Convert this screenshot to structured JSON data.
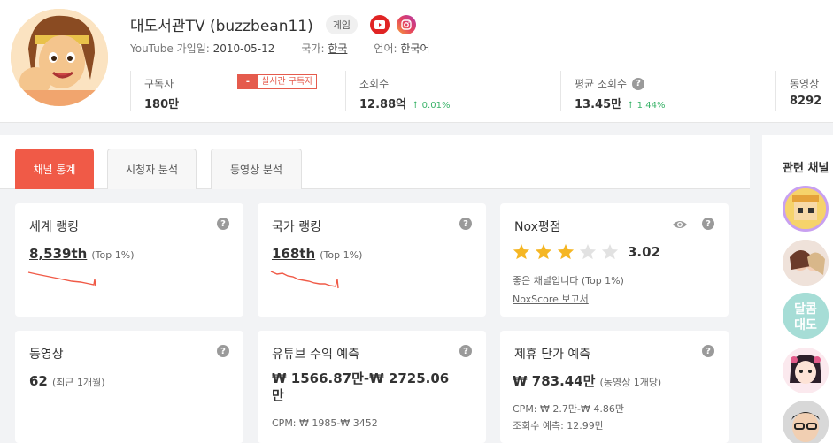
{
  "channel": {
    "name": "대도서관TV (buzzbean11)",
    "category": "게임",
    "joined_label": "YouTube 가입일:",
    "joined_value": "2010-05-12",
    "country_label": "국가:",
    "country_value": "한국",
    "language_label": "언어:",
    "language_value": "한국어"
  },
  "stats": {
    "subscribers_label": "구독자",
    "subscribers_value": "180만",
    "realtime_dash": "-",
    "realtime_label": "실시간 구독자",
    "views_label": "조회수",
    "views_value": "12.88억",
    "views_change": "0.01%",
    "avg_views_label": "평균 조회수",
    "avg_views_value": "13.45만",
    "avg_views_change": "1.44%",
    "videos_label": "동영상",
    "videos_value": "8292"
  },
  "tabs": [
    {
      "label": "채널 통계",
      "active": true
    },
    {
      "label": "시청자 분석",
      "active": false
    },
    {
      "label": "동영상 분석",
      "active": false
    }
  ],
  "cards": {
    "world_rank": {
      "title": "세계 랭킹",
      "value": "8,539th",
      "sub": "(Top 1%)"
    },
    "country_rank": {
      "title": "국가 랭킹",
      "value": "168th",
      "sub": "(Top 1%)"
    },
    "nox": {
      "title": "Nox평점",
      "score": "3.02",
      "stars": 3,
      "desc": "좋은 채널입니다 (Top 1%)",
      "report": "NoxScore 보고서"
    },
    "videos": {
      "title": "동영상",
      "value": "62",
      "sub": "(최근 1개월)"
    },
    "revenue": {
      "title": "유튜브 수익 예측",
      "value_line1": "₩ 1566.87만-₩ 2725.06",
      "value_line2": "만",
      "cpm": "CPM: ₩ 1985-₩ 3452"
    },
    "affiliate": {
      "title": "제휴 단가 예측",
      "value": "₩ 783.44만",
      "sub": "(동영상 1개당)",
      "cpm": "CPM: ₩ 2.7만-₩ 4.86만",
      "views_pred": "조회수 예측: 12.99만"
    }
  },
  "sidebar": {
    "title": "관련 채널"
  },
  "colors": {
    "accent": "#f05a47",
    "up": "#3bb36a",
    "star": "#f5b623"
  }
}
